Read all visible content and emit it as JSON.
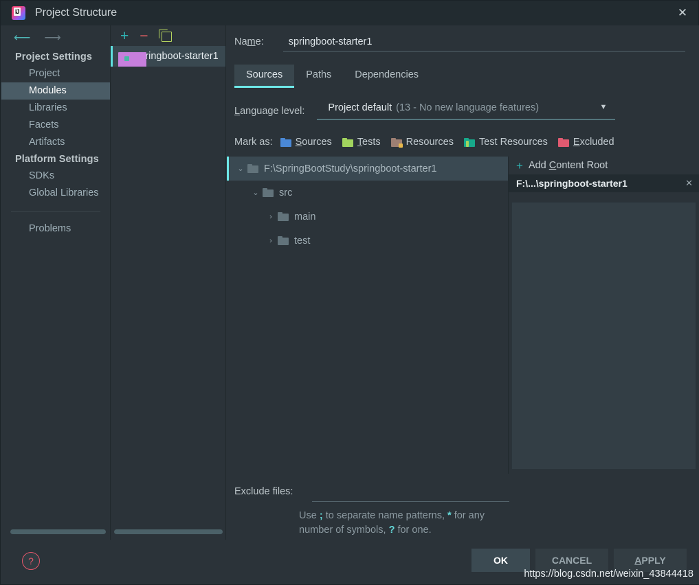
{
  "window": {
    "title": "Project Structure",
    "logo_icon": "intellij-idea-logo",
    "close_icon": "close-icon"
  },
  "sidebar": {
    "back_icon": "arrow-left-icon",
    "forward_icon": "arrow-right-icon",
    "groups": [
      {
        "title": "Project Settings",
        "items": [
          {
            "label": "Project",
            "selected": false
          },
          {
            "label": "Modules",
            "selected": true
          },
          {
            "label": "Libraries",
            "selected": false
          },
          {
            "label": "Facets",
            "selected": false
          },
          {
            "label": "Artifacts",
            "selected": false
          }
        ]
      },
      {
        "title": "Platform Settings",
        "items": [
          {
            "label": "SDKs",
            "selected": false
          },
          {
            "label": "Global Libraries",
            "selected": false
          }
        ]
      }
    ],
    "problems_label": "Problems"
  },
  "modules": {
    "toolbar": {
      "add_icon": "plus-icon",
      "remove_icon": "minus-icon",
      "copy_icon": "copy-icon"
    },
    "items": [
      {
        "label": "springboot-starter1",
        "icon": "module-icon",
        "selected": true
      }
    ]
  },
  "main": {
    "name_label": "Name:",
    "name_value": "springboot-starter1",
    "tabs": [
      {
        "label": "Sources",
        "active": true
      },
      {
        "label": "Paths",
        "active": false
      },
      {
        "label": "Dependencies",
        "active": false
      }
    ],
    "language_level": {
      "label": "Language level:",
      "value": "Project default",
      "detail": "(13 - No new language features)",
      "caret_icon": "chevron-down-icon"
    },
    "mark_as": {
      "label": "Mark as:",
      "options": [
        {
          "label": "Sources",
          "color": "#4a88d6",
          "style": "plain"
        },
        {
          "label": "Tests",
          "color": "#a2d45e",
          "style": "plain"
        },
        {
          "label": "Resources",
          "color": "#9d7f73",
          "style": "badge",
          "badge_color": "#e8b84b"
        },
        {
          "label": "Test Resources",
          "color": "#17a98b",
          "style": "strip",
          "strip_color": "#a2d45e"
        },
        {
          "label": "Excluded",
          "color": "#e05a70",
          "style": "plain"
        }
      ]
    },
    "tree": [
      {
        "label": "F:\\SpringBootStudy\\springboot-starter1",
        "depth": 0,
        "twisty": "⌄",
        "expanded": true,
        "selected": true
      },
      {
        "label": "src",
        "depth": 1,
        "twisty": "⌄",
        "expanded": true,
        "selected": false
      },
      {
        "label": "main",
        "depth": 2,
        "twisty": "›",
        "expanded": false,
        "selected": false
      },
      {
        "label": "test",
        "depth": 2,
        "twisty": "›",
        "expanded": false,
        "selected": false
      }
    ],
    "content_roots": {
      "add_label": "Add Content Root",
      "add_icon": "plus-icon",
      "items": [
        {
          "label": "F:\\...\\springboot-starter1",
          "remove_icon": "close-icon"
        }
      ]
    },
    "exclude": {
      "label": "Exclude files:",
      "value": "",
      "hint_prefix": "Use ",
      "hint_sep": ";",
      "hint_mid": " to separate name patterns, ",
      "hint_star": "*",
      "hint_mid2": " for any number of symbols, ",
      "hint_q": "?",
      "hint_end": " for one."
    }
  },
  "footer": {
    "help_icon": "help-icon",
    "buttons": [
      {
        "label": "OK",
        "primary": true
      },
      {
        "label": "CANCEL",
        "primary": false
      },
      {
        "label": "APPLY",
        "primary": false
      }
    ],
    "watermark": "https://blog.csdn.net/weixin_43844418"
  }
}
